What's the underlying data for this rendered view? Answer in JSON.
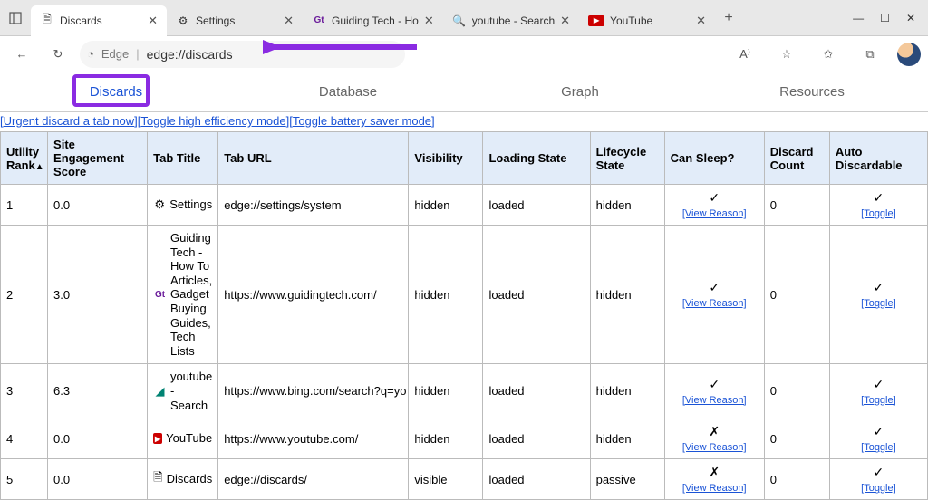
{
  "window": {
    "tabs": [
      {
        "label": "Discards",
        "icon": "document-icon",
        "active": true
      },
      {
        "label": "Settings",
        "icon": "gear-icon"
      },
      {
        "label": "Guiding Tech - Ho",
        "icon": "gt-icon"
      },
      {
        "label": "youtube - Search",
        "icon": "search-icon"
      },
      {
        "label": "YouTube",
        "icon": "yt-icon"
      }
    ],
    "controls": {
      "min": "—",
      "max": "☐",
      "close": "✕"
    }
  },
  "toolbar": {
    "edge_label": "Edge",
    "url": "edge://discards"
  },
  "pagetabs": [
    "Discards",
    "Database",
    "Graph",
    "Resources"
  ],
  "active_tab_index": 0,
  "action_links": [
    "Urgent discard a tab now",
    "Toggle high efficiency mode",
    "Toggle battery saver mode"
  ],
  "headers": [
    "Utility Rank",
    "Site Engagement Score",
    "Tab Title",
    "Tab URL",
    "Visibility",
    "Loading State",
    "Lifecycle State",
    "Can Sleep?",
    "Discard Count",
    "Auto Discardable"
  ],
  "view_reason": "[View Reason]",
  "toggle_label": "[Toggle]",
  "rows": [
    {
      "rank": "1",
      "score": "0.0",
      "icon": "gear",
      "title": "Settings",
      "url": "edge://settings/system",
      "vis": "hidden",
      "load": "loaded",
      "life": "hidden",
      "sleep": "✓",
      "sleep_reason": true,
      "discard": "0",
      "auto": "✓"
    },
    {
      "rank": "2",
      "score": "3.0",
      "icon": "gt",
      "title": "Guiding Tech - How To Articles, Gadget Buying Guides, Tech Lists",
      "url": "https://www.guidingtech.com/",
      "vis": "hidden",
      "load": "loaded",
      "life": "hidden",
      "sleep": "✓",
      "sleep_reason": true,
      "discard": "0",
      "auto": "✓"
    },
    {
      "rank": "3",
      "score": "6.3",
      "icon": "bing",
      "title": "youtube - Search",
      "url": "https://www.bing.com/search?q=yo",
      "vis": "hidden",
      "load": "loaded",
      "life": "hidden",
      "sleep": "✓",
      "sleep_reason": true,
      "discard": "0",
      "auto": "✓"
    },
    {
      "rank": "4",
      "score": "0.0",
      "icon": "yt",
      "title": "YouTube",
      "url": "https://www.youtube.com/",
      "vis": "hidden",
      "load": "loaded",
      "life": "hidden",
      "sleep": "✗",
      "sleep_reason": true,
      "discard": "0",
      "auto": "✓"
    },
    {
      "rank": "5",
      "score": "0.0",
      "icon": "doc",
      "title": "Discards",
      "url": "edge://discards/",
      "vis": "visible",
      "load": "loaded",
      "life": "passive",
      "sleep": "✗",
      "sleep_reason": true,
      "discard": "0",
      "auto": "✓"
    }
  ]
}
